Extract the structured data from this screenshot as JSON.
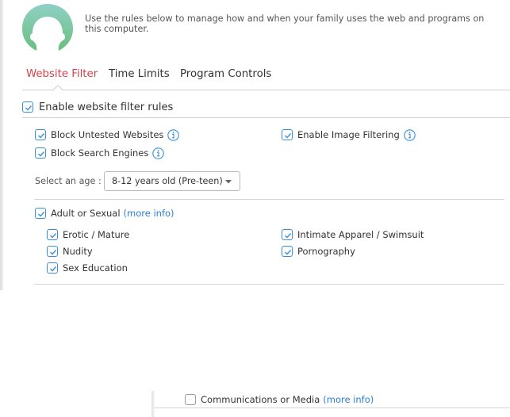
{
  "header": {
    "avatar_icon": "user-silhouette-icon",
    "description": "Use the rules below to manage how and when your family uses the web and programs on this computer."
  },
  "tabs": [
    {
      "label": "Website Filter",
      "active": true
    },
    {
      "label": "Time Limits",
      "active": false
    },
    {
      "label": "Program Controls",
      "active": false
    }
  ],
  "filter": {
    "enable_label": "Enable website filter rules",
    "enable_checked": true,
    "options": {
      "block_untested": {
        "label": "Block Untested Websites",
        "checked": true,
        "icon": "info-icon"
      },
      "block_search": {
        "label": "Block Search Engines",
        "checked": true,
        "icon": "info-icon"
      },
      "image_filtering": {
        "label": "Enable Image Filtering",
        "checked": true,
        "icon": "info-icon"
      }
    },
    "age": {
      "label": "Select an age :",
      "selected": "8-12 years old (Pre-teen)"
    }
  },
  "categories": {
    "adult": {
      "label": "Adult or Sexual",
      "link": "(more info)",
      "checked": true,
      "subs": [
        {
          "label": "Erotic / Mature",
          "checked": true
        },
        {
          "label": "Nudity",
          "checked": true
        },
        {
          "label": "Sex Education",
          "checked": true
        },
        {
          "label": "Intimate Apparel / Swimsuit",
          "checked": true
        },
        {
          "label": "Pornography",
          "checked": true
        }
      ]
    },
    "communications": {
      "label": "Communications or Media",
      "link": "(more info)",
      "checked": false
    }
  },
  "colors": {
    "accent_blue": "#3a8fd9",
    "active_tab_red": "#d9414a",
    "link_blue": "#2a7fd4",
    "avatar_top": "#8ccfc4",
    "avatar_bottom": "#6cc081"
  }
}
